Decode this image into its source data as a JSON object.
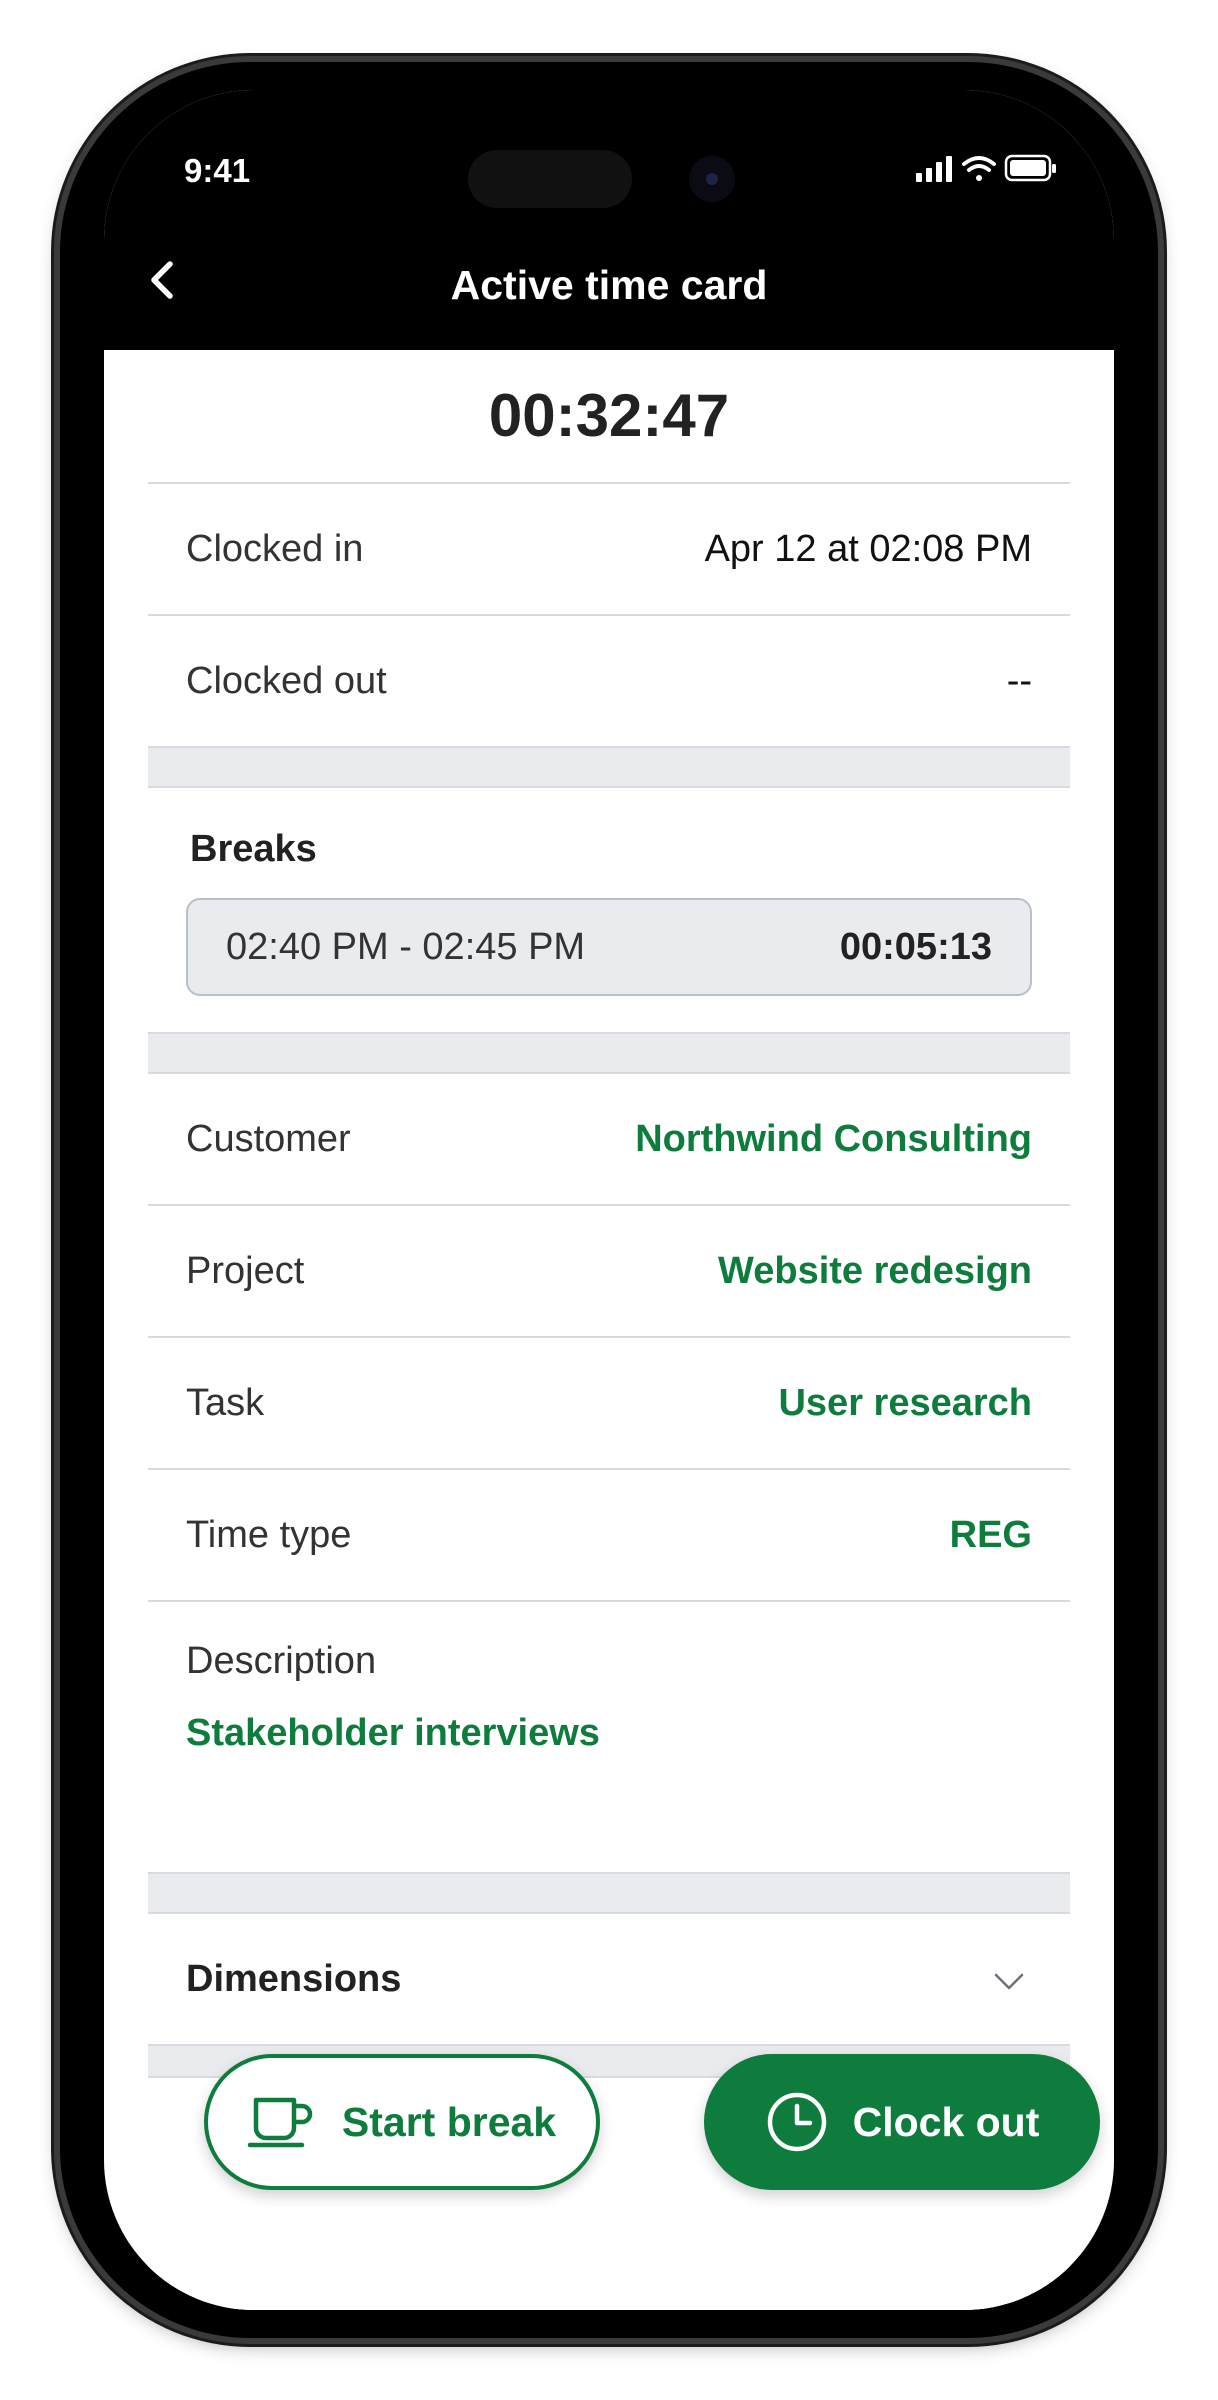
{
  "status_bar": {
    "time": "9:41"
  },
  "nav": {
    "title": "Active time card"
  },
  "timer": {
    "elapsed": "00:32:47"
  },
  "clock_rows": [
    {
      "label": "Clocked in",
      "value": "Apr 12 at 02:08 PM"
    },
    {
      "label": "Clocked out",
      "value": "--"
    }
  ],
  "breaks": {
    "title": "Breaks",
    "items": [
      {
        "range": "02:40 PM - 02:45 PM",
        "duration": "00:05:13"
      }
    ]
  },
  "details": [
    {
      "label": "Customer",
      "value": "Northwind Consulting"
    },
    {
      "label": "Project",
      "value": "Website redesign"
    },
    {
      "label": "Task",
      "value": "User research"
    },
    {
      "label": "Time type",
      "value": "REG"
    }
  ],
  "description": {
    "label": "Description",
    "value": "Stakeholder interviews"
  },
  "dimensions": {
    "label": "Dimensions"
  },
  "actions": {
    "start_break": "Start break",
    "clock_out": "Clock out"
  },
  "colors": {
    "accent": "#0d7c3d",
    "divider": "#d7dade",
    "gap": "#e9ebee"
  },
  "icons": [
    "back-chevron-icon",
    "signal-icon",
    "wifi-icon",
    "battery-icon",
    "chevron-down-icon",
    "coffee-cup-icon",
    "clock-icon"
  ]
}
